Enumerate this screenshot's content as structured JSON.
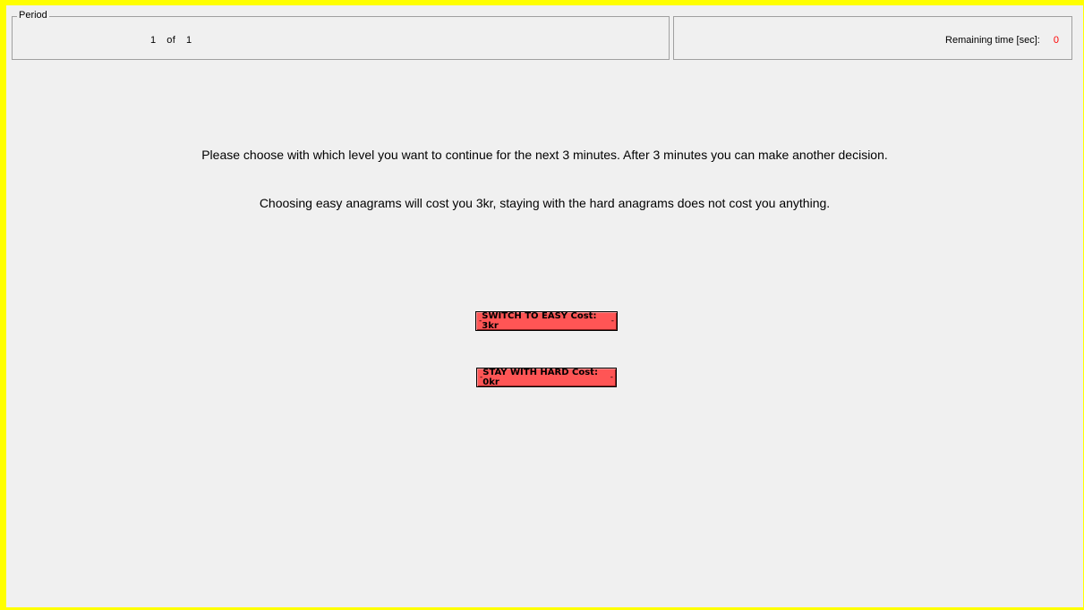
{
  "period": {
    "legend": "Period",
    "current": "1",
    "of_label": "of",
    "total": "1"
  },
  "timer": {
    "label": "Remaining time [sec]:",
    "value": "0",
    "value_color": "#ff0000"
  },
  "instructions": {
    "line1": "Please choose with which level you want to continue for the next 3 minutes. After 3 minutes you can make another decision.",
    "line2": "Choosing easy anagrams will cost you 3kr, staying with the hard anagrams does not cost you anything."
  },
  "buttons": {
    "switch_easy": "SWITCH TO EASY Cost: 3kr",
    "stay_hard": "STAY WITH HARD Cost: 0kr",
    "focus_marker": "-",
    "color": "#ff5555"
  },
  "colors": {
    "window_border": "#ffff00",
    "background": "#f0f0f0"
  }
}
